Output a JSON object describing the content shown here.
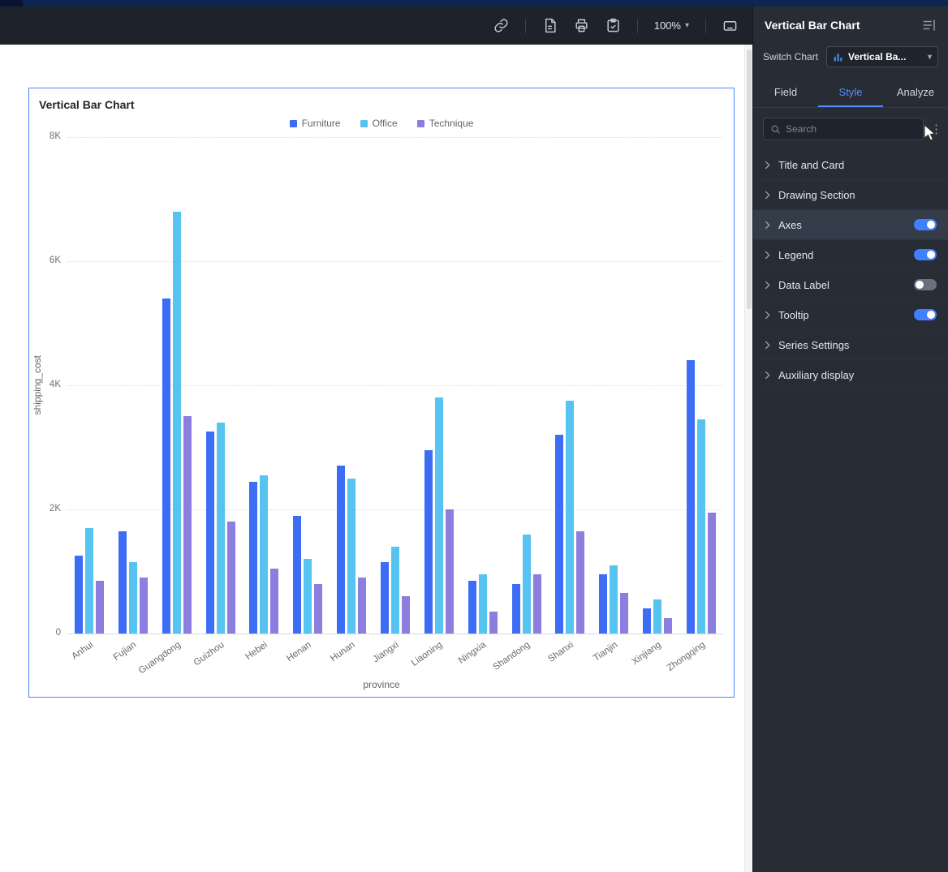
{
  "toolbar": {
    "zoom_label": "100%",
    "icons": [
      "link",
      "document",
      "printer",
      "clipboard-check",
      "keyboard"
    ]
  },
  "icons": {
    "zoom_caret": "▾",
    "select_caret": "▾",
    "more_vertical": "⋮"
  },
  "panel": {
    "title": "Vertical Bar Chart",
    "switch_chart_label": "Switch Chart",
    "chart_type_value": "Vertical Ba...",
    "tabs": [
      {
        "label": "Field",
        "active": false
      },
      {
        "label": "Style",
        "active": true
      },
      {
        "label": "Analyze",
        "active": false
      }
    ],
    "search_placeholder": "Search",
    "sections": [
      {
        "label": "Title and Card",
        "toggle": null,
        "highlight": false
      },
      {
        "label": "Drawing Section",
        "toggle": null,
        "highlight": false
      },
      {
        "label": "Axes",
        "toggle": "on",
        "highlight": true
      },
      {
        "label": "Legend",
        "toggle": "on",
        "highlight": false
      },
      {
        "label": "Data Label",
        "toggle": "off",
        "highlight": false
      },
      {
        "label": "Tooltip",
        "toggle": "on",
        "highlight": false
      },
      {
        "label": "Series Settings",
        "toggle": null,
        "highlight": false
      },
      {
        "label": "Auxiliary display",
        "toggle": null,
        "highlight": false
      }
    ]
  },
  "chart_data": {
    "type": "bar",
    "title": "Vertical Bar Chart",
    "xlabel": "province",
    "ylabel": "shipping_cost",
    "ylim": [
      0,
      8000
    ],
    "yticks": [
      "0",
      "2K",
      "4K",
      "6K",
      "8K"
    ],
    "grid": true,
    "legend_position": "top",
    "categories": [
      "Anhui",
      "Fujian",
      "Guangdong",
      "Guizhou",
      "Hebei",
      "Henan",
      "Hunan",
      "Jiangxi",
      "Liaoning",
      "Ningxia",
      "Shandong",
      "Shanxi",
      "Tianjin",
      "Xinjiang",
      "Zhongqing"
    ],
    "series": [
      {
        "name": "Furniture",
        "color": "#3d6df5",
        "values": [
          1250,
          1650,
          5400,
          3250,
          2450,
          1900,
          2700,
          1150,
          2950,
          850,
          800,
          3200,
          950,
          400,
          4400
        ]
      },
      {
        "name": "Office",
        "color": "#56c3f0",
        "values": [
          1700,
          1150,
          6800,
          3400,
          2550,
          1200,
          2500,
          1400,
          3800,
          950,
          1600,
          3750,
          1100,
          550,
          3450
        ]
      },
      {
        "name": "Technique",
        "color": "#8c7edf",
        "values": [
          850,
          900,
          3500,
          1800,
          1050,
          800,
          900,
          600,
          2000,
          350,
          950,
          1650,
          650,
          250,
          1950
        ]
      }
    ]
  }
}
